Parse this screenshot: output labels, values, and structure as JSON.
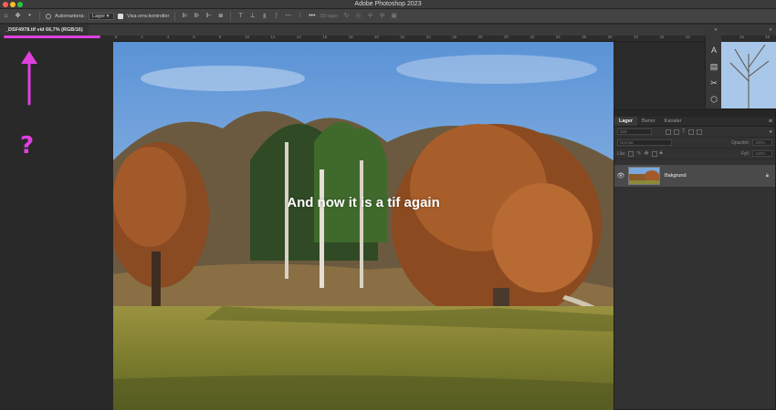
{
  "window": {
    "title": "Adobe Photoshop 2023"
  },
  "options_bar": {
    "auto_select_label": "Automarkera:",
    "auto_select_value": "Lager",
    "show_transform_label": "Visa omv.kontroller",
    "mode_3d_label": "3D-läge:"
  },
  "document": {
    "tab_title": "_DSF4978.tif vid 66,7% (RGB/16)",
    "overlay_text": "And now it is a tif again",
    "annotation": "?"
  },
  "ruler": {
    "ticks": [
      "6",
      "2",
      "4",
      "6",
      "8",
      "10",
      "12",
      "14",
      "16",
      "18",
      "20",
      "22",
      "24",
      "26",
      "28",
      "30",
      "32",
      "34",
      "36",
      "38",
      "40",
      "42",
      "44",
      "46"
    ]
  },
  "right_ruler": {
    "ticks": [
      "46",
      "48"
    ]
  },
  "tool_icons": [
    "character-style-icon",
    "notes-icon",
    "scissors-icon",
    "3d-cube-icon"
  ],
  "layers_panel": {
    "tabs": [
      "Lager",
      "Banor",
      "Kanaler"
    ],
    "active_tab": "Lager",
    "search_placeholder": "Sök",
    "blend_mode": "Normal",
    "opacity_label": "Opacitet:",
    "opacity_value": "100%",
    "lock_label": "Lås:",
    "fill_label": "Fyll:",
    "fill_value": "100%",
    "layers": [
      {
        "name": "Bakgrund",
        "visible": true,
        "locked": true
      }
    ]
  },
  "colors": {
    "accent_annotation": "#e040e0",
    "panel_bg": "#323232",
    "app_bg": "#2a2a2a"
  }
}
